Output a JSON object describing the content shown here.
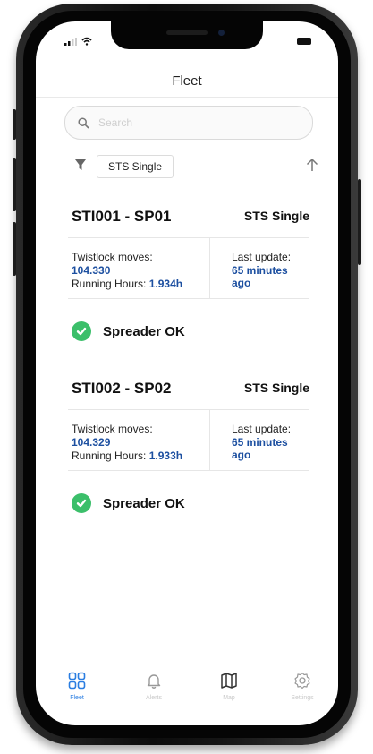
{
  "header": {
    "title": "Fleet"
  },
  "search": {
    "placeholder": "Search"
  },
  "filter": {
    "chip_label": "STS Single"
  },
  "fleet": [
    {
      "name": "STI001 - SP01",
      "type": "STS Single",
      "twistlock_label": "Twistlock moves:",
      "twistlock_value": "104.330",
      "running_hours_label": "Running Hours:",
      "running_hours_value": "1.934h",
      "last_update_label": "Last update:",
      "last_update_value": "65 minutes ago",
      "status": "Spreader OK"
    },
    {
      "name": "STI002 - SP02",
      "type": "STS Single",
      "twistlock_label": "Twistlock moves:",
      "twistlock_value": "104.329",
      "running_hours_label": "Running Hours:",
      "running_hours_value": "1.933h",
      "last_update_label": "Last update:",
      "last_update_value": "65 minutes ago",
      "status": "Spreader OK"
    }
  ],
  "tabs": [
    {
      "label": "Fleet",
      "icon": "grid-icon",
      "active": true
    },
    {
      "label": "Alerts",
      "icon": "bell-icon",
      "active": false
    },
    {
      "label": "Map",
      "icon": "map-icon",
      "active": false
    },
    {
      "label": "Settings",
      "icon": "gear-icon",
      "active": false
    }
  ],
  "colors": {
    "accent": "#2a7de1",
    "value_blue": "#1c4fa0",
    "ok_green": "#3bbf6a"
  }
}
